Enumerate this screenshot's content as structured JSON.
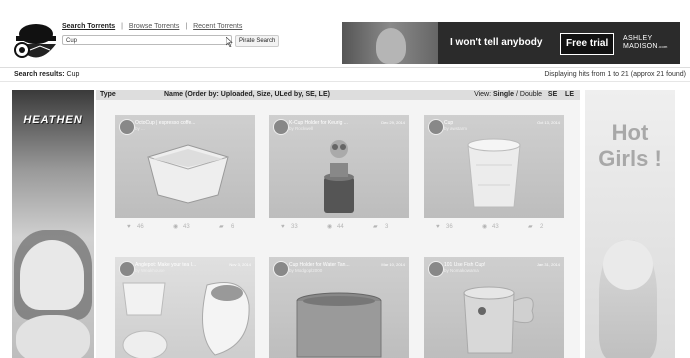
{
  "nav": {
    "search_torrents": "Search Torrents",
    "browse_torrents": "Browse Torrents",
    "recent_torrents": "Recent Torrents",
    "separator": "|"
  },
  "search": {
    "value": "Cup",
    "button_label": "Pirate Search"
  },
  "banner": {
    "slogan": "I won't tell anybody",
    "trial_button": "Free trial",
    "brand_line1": "ASHLEY",
    "brand_line2": "MADISON",
    "brand_suffix": ".com"
  },
  "results": {
    "label": "Search results:",
    "query": "Cup",
    "summary": "Displaying hits from 1 to 21 (approx 21 found)"
  },
  "grid_header": {
    "type": "Type",
    "name": "Name (Order by: Uploaded, Size, ULed by, SE, LE)",
    "view_label": "View:",
    "view_single": "Single",
    "view_sep": "/",
    "view_double": "Double",
    "se": "SE",
    "le": "LE"
  },
  "ads": {
    "left_title": "HEATHEN",
    "right_line1": "Hot",
    "right_line2": "Girls !"
  },
  "cards": [
    {
      "title": "OctoCup | espresso coffe...",
      "by": "by ...",
      "date": "",
      "likes": "46",
      "views": "43",
      "comments": "6"
    },
    {
      "title": "K-Cup Holder for Keurig ...",
      "by": "by Rockwell",
      "date": "Dec 29, 2014",
      "likes": "33",
      "views": "44",
      "comments": "3"
    },
    {
      "title": "Cup",
      "by": "by awstarm",
      "date": "Oct 13, 2014",
      "likes": "36",
      "views": "43",
      "comments": "2"
    },
    {
      "title": "Anglepot: Make your tea I...",
      "by": "by Weakhouse",
      "date": "Nov 3, 2014",
      "likes": "",
      "views": "",
      "comments": ""
    },
    {
      "title": "Cup Holder for Water Tan...",
      "by": "by Modgopl2000",
      "date": "Mar 10, 2014",
      "likes": "",
      "views": "",
      "comments": ""
    },
    {
      "title": "101 Use Fish Cup!",
      "by": "by Nomakowama",
      "date": "Jan 31, 2014",
      "likes": "",
      "views": "",
      "comments": ""
    }
  ],
  "icons": {
    "like": "heart-icon",
    "views": "eye-icon",
    "comments": "chat-icon"
  }
}
